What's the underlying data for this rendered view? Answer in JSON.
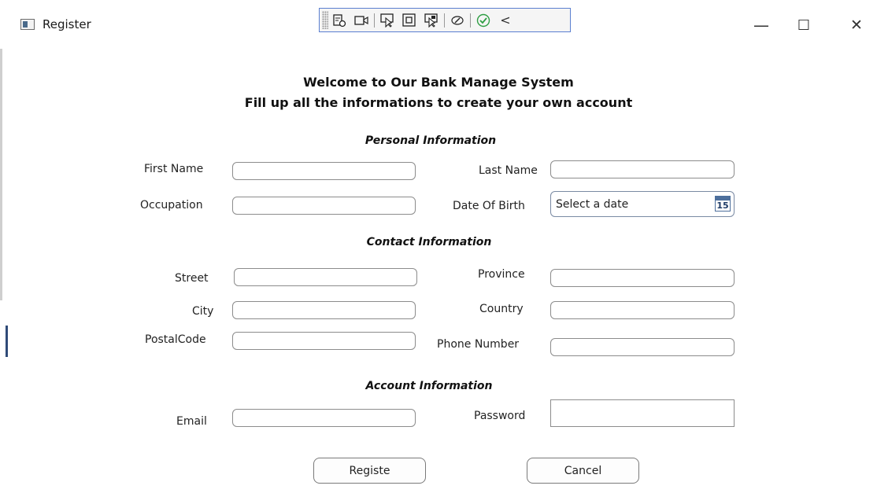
{
  "window": {
    "title": "Register",
    "minimize": "—",
    "maximize": "☐",
    "close": "✕"
  },
  "toolbar": {
    "icons": [
      "select-element-icon",
      "record-icon",
      "pointer-icon",
      "frame-icon",
      "track-focus-icon",
      "binding-icon",
      "check-icon",
      "collapse-icon"
    ],
    "collapse": "<"
  },
  "header": {
    "line1": "Welcome to Our Bank Manage System",
    "line2": "Fill up all the informations to create your own account"
  },
  "sections": {
    "personal": "Personal Information",
    "contact": "Contact Information",
    "account": "Account Information"
  },
  "labels": {
    "first_name": "First Name",
    "last_name": "Last Name",
    "occupation": "Occupation",
    "dob": "Date Of Birth",
    "street": "Street",
    "province": "Province",
    "city": "City",
    "country": "Country",
    "postal_code": "PostalCode",
    "phone": "Phone Number",
    "email": "Email",
    "password": "Password"
  },
  "date_picker": {
    "placeholder": "Select a date",
    "calendar_day": "15"
  },
  "buttons": {
    "register": "Registe",
    "cancel": "Cancel"
  }
}
